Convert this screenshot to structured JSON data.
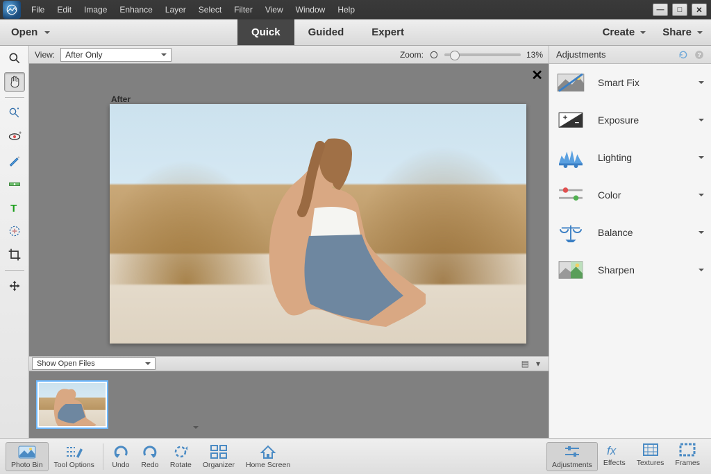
{
  "menu": [
    "File",
    "Edit",
    "Image",
    "Enhance",
    "Layer",
    "Select",
    "Filter",
    "View",
    "Window",
    "Help"
  ],
  "modebar": {
    "open": "Open",
    "modes": [
      "Quick",
      "Guided",
      "Expert"
    ],
    "active": "Quick",
    "create": "Create",
    "share": "Share"
  },
  "viewbar": {
    "view_label": "View:",
    "view_value": "After Only",
    "zoom_label": "Zoom:",
    "zoom_value": "13%"
  },
  "canvas": {
    "after_label": "After"
  },
  "bin": {
    "select": "Show Open Files"
  },
  "panel": {
    "title": "Adjustments",
    "items": [
      "Smart Fix",
      "Exposure",
      "Lighting",
      "Color",
      "Balance",
      "Sharpen"
    ]
  },
  "bottom_left": [
    "Photo Bin",
    "Tool Options",
    "Undo",
    "Redo",
    "Rotate",
    "Organizer",
    "Home Screen"
  ],
  "bottom_right": [
    "Adjustments",
    "Effects",
    "Textures",
    "Frames"
  ]
}
